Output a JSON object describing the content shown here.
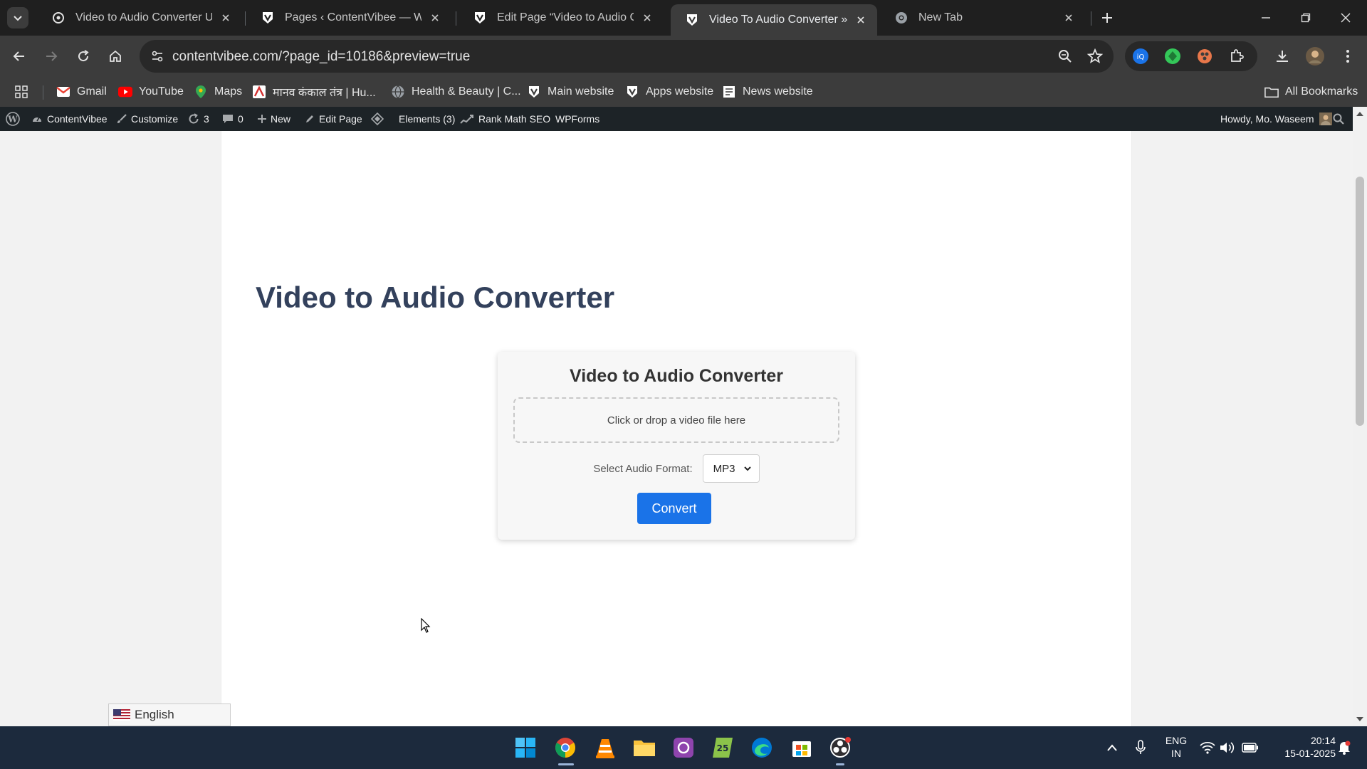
{
  "browser": {
    "tabs": [
      {
        "title": "Video to Audio Converter UI",
        "favicon": "chatgpt-icon",
        "active": false
      },
      {
        "title": "Pages ‹ ContentVibee — WordPress",
        "favicon": "contentvibee-icon",
        "active": false
      },
      {
        "title": "Edit Page “Video to Audio Converter”",
        "favicon": "contentvibee-icon",
        "active": false
      },
      {
        "title": "Video To Audio Converter » ContentVibee",
        "favicon": "contentvibee-icon",
        "active": true
      },
      {
        "title": "New Tab",
        "favicon": "chrome-icon",
        "active": false
      }
    ],
    "address_bar": {
      "url": "contentvibee.com/?page_id=10186&preview=true"
    },
    "bookmarks": [
      {
        "label": "Gmail",
        "icon": "gmail-icon"
      },
      {
        "label": "YouTube",
        "icon": "youtube-icon"
      },
      {
        "label": "Maps",
        "icon": "maps-icon"
      },
      {
        "label": "मानव कंकाल तंत्र | Hu...",
        "icon": "bookmark-site-icon"
      },
      {
        "label": "Health & Beauty | C...",
        "icon": "globe-icon"
      },
      {
        "label": "Main website",
        "icon": "contentvibee-icon"
      },
      {
        "label": "Apps website",
        "icon": "contentvibee-icon"
      },
      {
        "label": "News website",
        "icon": "news-icon"
      }
    ],
    "all_bookmarks_label": "All Bookmarks"
  },
  "wp_admin_bar": {
    "site_name": "ContentVibee",
    "customize": "Customize",
    "updates_count": "3",
    "comments_count": "0",
    "new_label": "New",
    "edit_page": "Edit Page",
    "elements": "Elements (3)",
    "rank_math": "Rank Math SEO",
    "wpforms": "WPForms",
    "howdy": "Howdy, Mo. Waseem"
  },
  "page": {
    "title": "Video to Audio Converter",
    "converter": {
      "title": "Video to Audio Converter",
      "dropzone_text": "Click or drop a video file here",
      "format_label": "Select Audio Format:",
      "format_selected": "MP3",
      "convert_label": "Convert"
    },
    "language_switcher": "English"
  },
  "taskbar": {
    "language": "ENG",
    "region": "IN",
    "time": "20:14",
    "date": "15-01-2025"
  }
}
